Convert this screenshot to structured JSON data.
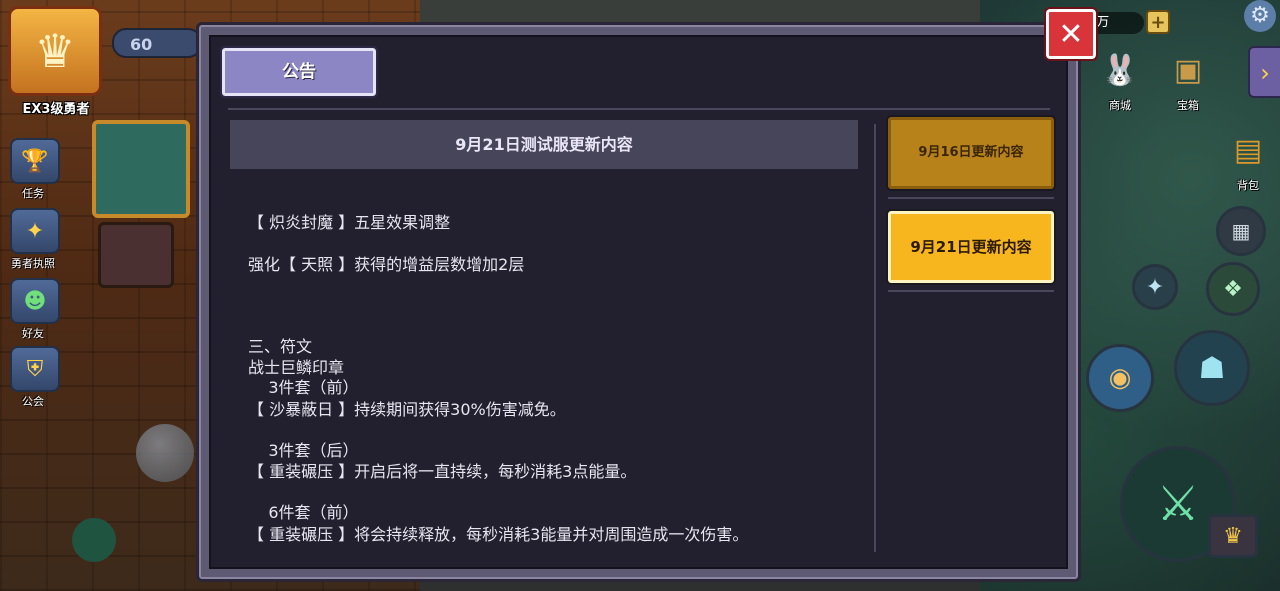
{
  "hud_left": {
    "rank": "EX3级勇者",
    "level": "60",
    "buttons": [
      {
        "label": "任务",
        "icon": "quest-icon"
      },
      {
        "label": "勇者执照",
        "icon": "license-icon"
      },
      {
        "label": "好友",
        "icon": "friend-icon"
      },
      {
        "label": "公会",
        "icon": "guild-icon"
      }
    ]
  },
  "hud_right": {
    "currency": "9万",
    "plus": "+",
    "shop_label": "商城",
    "chest_label": "宝箱",
    "bag_label": "背包"
  },
  "dialog": {
    "close_label": "✕",
    "tab_label": "公告",
    "article_title": "9月21日测试服更新内容",
    "article_lines": [
      "【 炽炎封魔 】五星效果调整",
      "强化【 天照 】获得的增益层数增加2层",
      "三、符文",
      "战士巨鳞印章",
      "    3件套（前）",
      "【 沙暴蔽日 】持续期间获得30%伤害减免。",
      "    3件套（后）",
      "【 重装碾压 】开启后将一直持续，每秒消耗3点能量。",
      "    6件套（前）",
      "【 重装碾压 】将会持续释放，每秒消耗3能量并对周围造成一次伤害。"
    ],
    "side_items": [
      {
        "label": "9月16日更新内容",
        "active": false
      },
      {
        "label": "9月21日更新内容",
        "active": true
      }
    ]
  },
  "colors": {
    "dialog_bg": "#22202f",
    "frame": "#5f5a73",
    "tab": "#8d86c4",
    "active_item": "#f7b61e",
    "inactive_item": "#b7821a",
    "close": "#d8343a"
  }
}
